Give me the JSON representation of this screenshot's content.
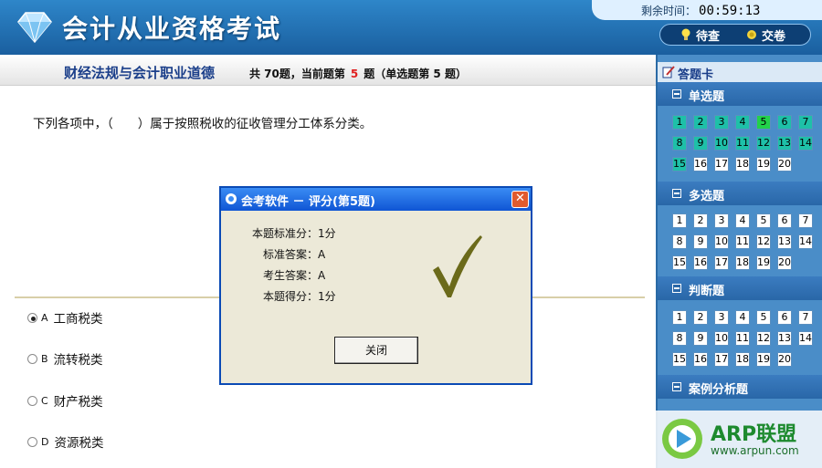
{
  "header": {
    "title": "会计从业资格考试",
    "timer_label": "剩余时间：",
    "timer_value": "00:59:13",
    "buttons": [
      {
        "label": "待查",
        "icon": "lightbulb-icon"
      },
      {
        "label": "交卷",
        "icon": "submit-icon"
      }
    ]
  },
  "subject": {
    "title": "财经法规与会计职业道德",
    "info_prefix": "共 70题，当前题第",
    "current": "5",
    "info_suffix": "题（单选题第 5 题）"
  },
  "question": {
    "text": "下列各项中，（　　）属于按照税收的征收管理分工体系分类。",
    "options": [
      {
        "letter": "A",
        "text": "工商税类",
        "selected": true
      },
      {
        "letter": "B",
        "text": "流转税类",
        "selected": false
      },
      {
        "letter": "C",
        "text": "财产税类",
        "selected": false
      },
      {
        "letter": "D",
        "text": "资源税类",
        "selected": false
      }
    ]
  },
  "answer_card": {
    "title": "答题卡",
    "sections": [
      {
        "title": "单选题",
        "numbers": [
          "1",
          "2",
          "3",
          "4",
          "5",
          "6",
          "7",
          "8",
          "9",
          "10",
          "11",
          "12",
          "13",
          "14",
          "15",
          "16",
          "17",
          "18",
          "19",
          "20"
        ],
        "answered_count": 15,
        "current": "5"
      },
      {
        "title": "多选题",
        "numbers": [
          "1",
          "2",
          "3",
          "4",
          "5",
          "6",
          "7",
          "8",
          "9",
          "10",
          "11",
          "12",
          "13",
          "14",
          "15",
          "16",
          "17",
          "18",
          "19",
          "20"
        ],
        "answered_count": 0
      },
      {
        "title": "判断题",
        "numbers": [
          "1",
          "2",
          "3",
          "4",
          "5",
          "6",
          "7",
          "8",
          "9",
          "10",
          "11",
          "12",
          "13",
          "14",
          "15",
          "16",
          "17",
          "18",
          "19",
          "20"
        ],
        "answered_count": 0
      },
      {
        "title": "案例分析题"
      }
    ]
  },
  "dialog": {
    "title": "会考软件 － 评分(第5题)",
    "rows": [
      {
        "label": "本题标准分：",
        "value": "1分"
      },
      {
        "label": "标准答案：",
        "value": "A"
      },
      {
        "label": "考生答案：",
        "value": "A"
      },
      {
        "label": "本题得分：",
        "value": "1分"
      }
    ],
    "close_label": "关闭",
    "result_icon": "checkmark-icon"
  },
  "watermark": {
    "brand": "ARP联盟",
    "url": "www.arpun.com"
  },
  "colors": {
    "header": "#1a5f9f",
    "side_panel": "#4a8dc8",
    "answered": "#1ec0a8",
    "current": "#22d24a",
    "dialog_title": "#0f55d4",
    "checkmark": "#6b6a1a"
  }
}
